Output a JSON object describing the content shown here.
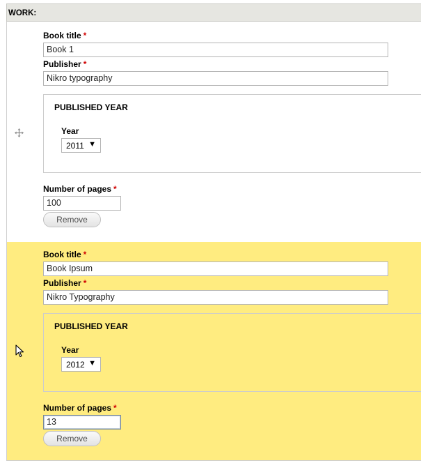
{
  "section": {
    "title": "WORK:"
  },
  "labels": {
    "book_title": "Book title",
    "publisher": "Publisher",
    "published_year": "PUBLISHED YEAR",
    "year": "Year",
    "number_of_pages": "Number of pages",
    "required_marker": "*",
    "remove": "Remove"
  },
  "items": [
    {
      "book_title": "Book 1",
      "publisher": "Nikro typography",
      "year": "2011",
      "pages": "100",
      "highlighted": false
    },
    {
      "book_title": "Book Ipsum",
      "publisher": "Nikro Typography",
      "year": "2012",
      "pages": "13",
      "highlighted": true
    }
  ],
  "icons": {
    "drag_handle": "drag-handle-icon",
    "cursor": "mouse-pointer-icon",
    "select_caret": "▼"
  },
  "colors": {
    "highlight_row": "#ffec80",
    "required": "#d00000",
    "header_bg": "#e6e6e1"
  }
}
